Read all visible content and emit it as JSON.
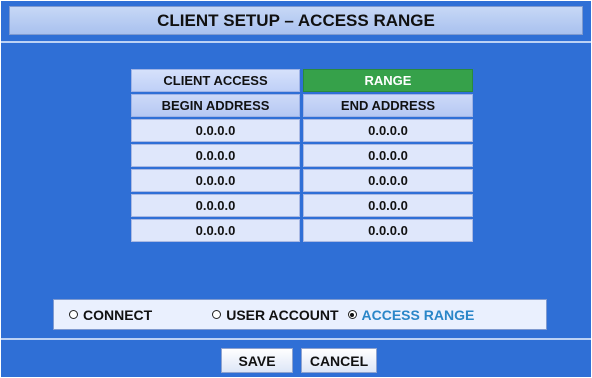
{
  "window": {
    "title": "CLIENT SETUP – ACCESS RANGE"
  },
  "table": {
    "tabs": [
      {
        "label": "CLIENT ACCESS",
        "active": false
      },
      {
        "label": "RANGE",
        "active": true
      }
    ],
    "columns": [
      "BEGIN ADDRESS",
      "END ADDRESS"
    ],
    "rows": [
      [
        "0.0.0.0",
        "0.0.0.0"
      ],
      [
        "0.0.0.0",
        "0.0.0.0"
      ],
      [
        "0.0.0.0",
        "0.0.0.0"
      ],
      [
        "0.0.0.0",
        "0.0.0.0"
      ],
      [
        "0.0.0.0",
        "0.0.0.0"
      ]
    ]
  },
  "modes": {
    "options": [
      {
        "label": "CONNECT",
        "selected": false
      },
      {
        "label": "USER ACCOUNT",
        "selected": false
      },
      {
        "label": "ACCESS RANGE",
        "selected": true
      }
    ]
  },
  "buttons": {
    "save": "SAVE",
    "cancel": "CANCEL"
  },
  "colors": {
    "background": "#2f6fd6",
    "active_tab": "#36a14a",
    "selected_mode": "#2a86c8"
  }
}
